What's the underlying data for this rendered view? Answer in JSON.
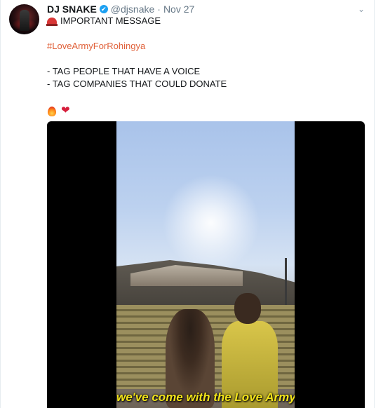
{
  "tweet": {
    "author_name": "DJ SNAKE",
    "handle": "@djsnake",
    "separator": "·",
    "time": "Nov 27",
    "verified_glyph": "✔",
    "caret": "⌄",
    "lines": {
      "important": "IMPORTANT MESSAGE",
      "hashtag": "#LoveArmyForRohingya",
      "tag_people": "- TAG PEOPLE THAT HAVE A VOICE",
      "tag_companies": "- TAG COMPANIES THAT COULD DONATE"
    },
    "emojis": {
      "siren": "police-light-icon",
      "fire": "fire-icon",
      "heart": "❤"
    }
  },
  "media": {
    "caption": "we've come with the Love Army"
  },
  "colors": {
    "hashtag": "#e0613a",
    "verified": "#1da1f2",
    "caption": "#f2e31a"
  }
}
